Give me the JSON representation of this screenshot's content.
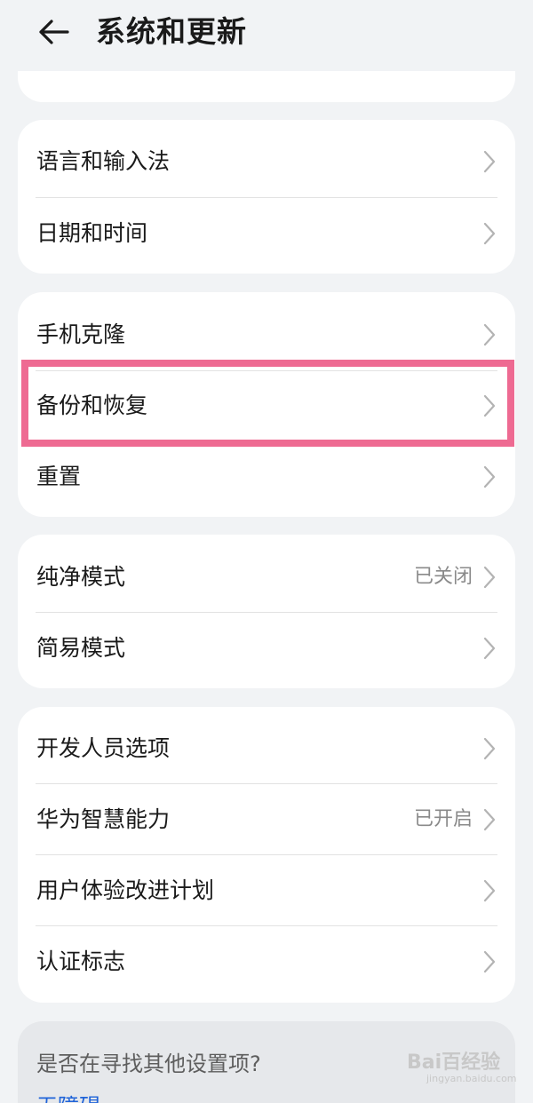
{
  "header": {
    "title": "系统和更新",
    "back_icon": "arrow-left-icon"
  },
  "groups": [
    {
      "items": [
        {
          "label": "语言和输入法",
          "value": ""
        },
        {
          "label": "日期和时间",
          "value": ""
        }
      ]
    },
    {
      "items": [
        {
          "label": "手机克隆",
          "value": ""
        },
        {
          "label": "备份和恢复",
          "value": "",
          "highlighted": true
        },
        {
          "label": "重置",
          "value": ""
        }
      ]
    },
    {
      "items": [
        {
          "label": "纯净模式",
          "value": "已关闭"
        },
        {
          "label": "简易模式",
          "value": ""
        }
      ]
    },
    {
      "items": [
        {
          "label": "开发人员选项",
          "value": ""
        },
        {
          "label": "华为智慧能力",
          "value": "已开启"
        },
        {
          "label": "用户体验改进计划",
          "value": ""
        },
        {
          "label": "认证标志",
          "value": ""
        }
      ]
    }
  ],
  "find_more": {
    "title": "是否在寻找其他设置项?",
    "link": "无障碍"
  },
  "watermark": {
    "brand": "Bai百经验",
    "sub": "jingyan.baidu.com"
  },
  "colors": {
    "background": "#f1f3f5",
    "card": "#ffffff",
    "highlight": "#ee6a92",
    "link": "#1f63d8"
  }
}
